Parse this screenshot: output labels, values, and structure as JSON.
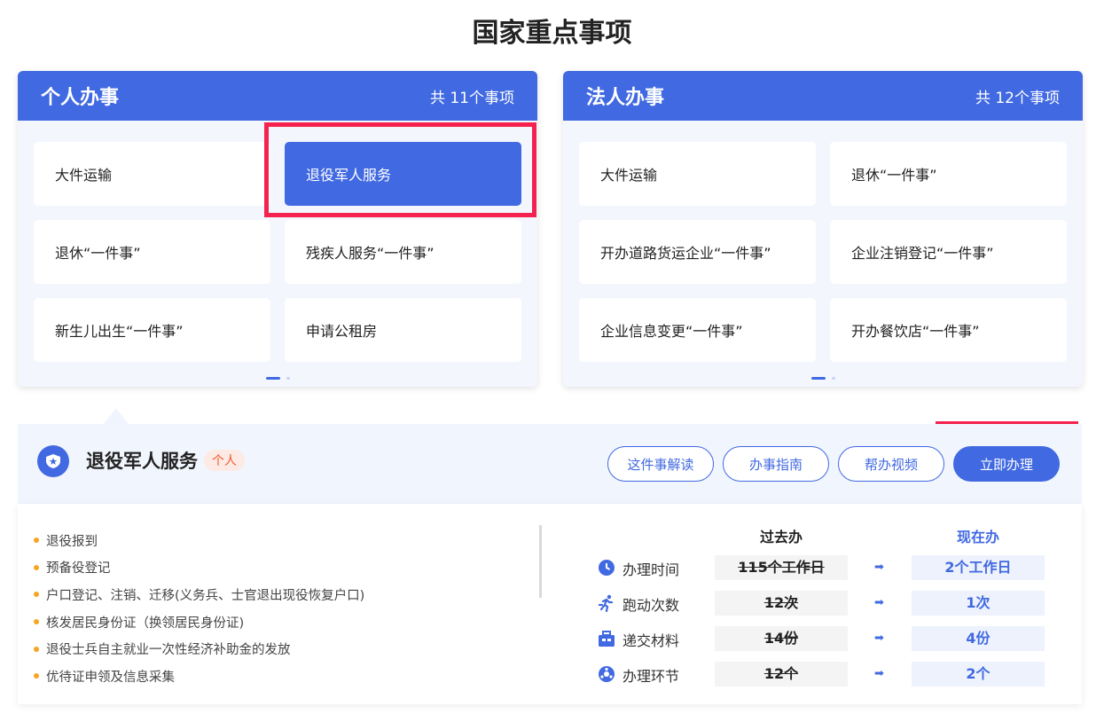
{
  "page": {
    "title": "国家重点事项"
  },
  "personal": {
    "title": "个人办事",
    "count": "共 11个事项",
    "items": [
      "大件运输",
      "退役军人服务",
      "退休“一件事”",
      "残疾人服务“一件事”",
      "新生儿出生“一件事”",
      "申请公租房"
    ],
    "active_item": "退役军人服务"
  },
  "legal": {
    "title": "法人办事",
    "count": "共 12个事项",
    "items": [
      "大件运输",
      "退休“一件事”",
      "开办道路货运企业“一件事”",
      "企业注销登记“一件事”",
      "企业信息变更“一件事”",
      "开办餐饮店“一件事”"
    ]
  },
  "detail": {
    "name": "退役军人服务",
    "tag": "个人",
    "buttons": {
      "interpret": "这件事解读",
      "guide": "办事指南",
      "video": "帮办视频",
      "apply": "立即办理"
    },
    "materials": [
      "退役报到",
      "预备役登记",
      "户口登记、注销、迁移(义务兵、士官退出现役恢复户口)",
      "核发居民身份证（换领居民身份证)",
      "退役士兵自主就业一次性经济补助金的发放",
      "优待证申领及信息采集"
    ],
    "comparison": {
      "past_header": "过去办",
      "now_header": "现在办",
      "rows": [
        {
          "icon": "clock-icon",
          "label": "办理时间",
          "past": "115个工作日",
          "now": "2个工作日"
        },
        {
          "icon": "running-icon",
          "label": "跑动次数",
          "past": "12次",
          "now": "1次"
        },
        {
          "icon": "briefcase-icon",
          "label": "递交材料",
          "past": "14份",
          "now": "4份"
        },
        {
          "icon": "process-icon",
          "label": "办理环节",
          "past": "12个",
          "now": "2个"
        }
      ]
    }
  },
  "colors": {
    "primary": "#4169e1",
    "highlight": "#f5214f",
    "tag_text": "#f15a2b",
    "bullet": "#f5a623"
  }
}
